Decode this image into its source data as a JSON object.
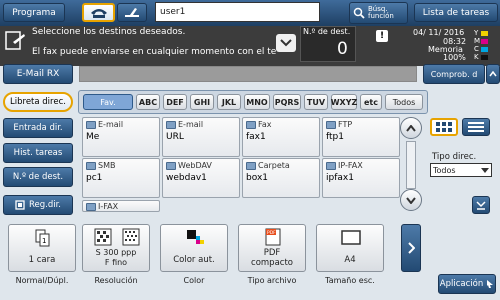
{
  "top": {
    "programa": "Programa",
    "user": "user1",
    "busqueda_line1": "Búsq.",
    "busqueda_line2": "función",
    "lista": "Lista de tareas"
  },
  "message": {
    "line1": "Seleccione los destinos deseados.",
    "line2": "El fax puede enviarse en cualquier momento con el te",
    "dest_label": "N.º de dest.",
    "dest_count": "0",
    "date": "04/ 11/ 2016",
    "time": "08:32",
    "memory_label": "Memoria",
    "memory_pct": "100%",
    "toner": [
      {
        "label": "Y",
        "color": "#f2d100"
      },
      {
        "label": "M",
        "color": "#d9008a"
      },
      {
        "label": "C",
        "color": "#00a7e1"
      },
      {
        "label": "K",
        "color": "#111111"
      }
    ]
  },
  "row2": {
    "email_rx": "E-Mail RX",
    "comprob": "Comprob. d"
  },
  "nav": [
    "Libreta direc.",
    "Entrada dir.",
    "Hist. tareas",
    "N.º de dest.",
    "Reg.dir."
  ],
  "tabs": [
    "Fav.",
    "ABC",
    "DEF",
    "GHI",
    "JKL",
    "MNO",
    "PQRS",
    "TUV",
    "WXYZ",
    "etc",
    "Todos"
  ],
  "cells": [
    {
      "type": "E-mail",
      "name": "Me"
    },
    {
      "type": "E-mail",
      "name": "URL"
    },
    {
      "type": "Fax",
      "name": "fax1"
    },
    {
      "type": "FTP",
      "name": "ftp1"
    },
    {
      "type": "SMB",
      "name": "pc1"
    },
    {
      "type": "WebDAV",
      "name": "webdav1"
    },
    {
      "type": "Carpeta",
      "name": "box1"
    },
    {
      "type": "IP-FAX",
      "name": "ipfax1"
    },
    {
      "type": "I-FAX",
      "name": ""
    }
  ],
  "tipo": {
    "label": "Tipo direc.",
    "value": "Todos"
  },
  "quick": [
    {
      "value": "1 cara",
      "label": "Normal/Dúpl."
    },
    {
      "value": "S 300 ppp\nF fino",
      "label": "Resolución"
    },
    {
      "value": "Color aut.",
      "label": "Color"
    },
    {
      "value": "PDF\ncompacto",
      "label": "Tipo archivo"
    },
    {
      "value": "A4",
      "label": "Tamaño esc."
    }
  ],
  "aplicacion": "Aplicación",
  "colors": {
    "accent": "#e7a300",
    "header": "#1e3f63",
    "fav_tab": "#7fa6d6"
  }
}
